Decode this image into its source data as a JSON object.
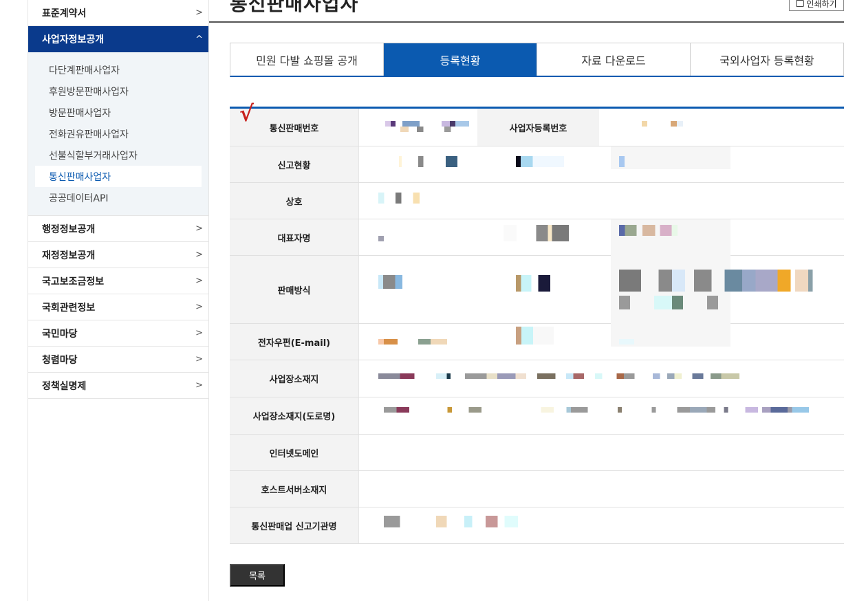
{
  "sidebar": {
    "items_top": [
      {
        "label": "표준계약서"
      }
    ],
    "active_section": {
      "label": "사업자정보공개"
    },
    "sub_items": [
      {
        "label": "다단계판매사업자"
      },
      {
        "label": "후원방문판매사업자"
      },
      {
        "label": "방문판매사업자"
      },
      {
        "label": "전화권유판매사업자"
      },
      {
        "label": "선불식할부거래사업자"
      },
      {
        "label": "통신판매사업자"
      },
      {
        "label": "공공데이터API"
      }
    ],
    "items_bottom": [
      {
        "label": "행정정보공개"
      },
      {
        "label": "재정정보공개"
      },
      {
        "label": "국고보조금정보"
      },
      {
        "label": "국회관련정보"
      },
      {
        "label": "국민마당"
      },
      {
        "label": "청렴마당"
      },
      {
        "label": "정책실명제"
      }
    ]
  },
  "header": {
    "title": "통신판매사업자",
    "print_label": "인쇄하기"
  },
  "tabs": [
    {
      "label": "민원 다발 쇼핑몰 공개"
    },
    {
      "label": "등록현황"
    },
    {
      "label": "자료 다운로드"
    },
    {
      "label": "국외사업자 등록현황"
    }
  ],
  "table": {
    "check": "√",
    "rows": [
      {
        "label": "통신판매번호",
        "label2": "사업자등록번호"
      },
      {
        "label": "신고현황"
      },
      {
        "label": "상호"
      },
      {
        "label": "대표자명"
      },
      {
        "label": "판매방식"
      },
      {
        "label": "전자우편(E-mail)"
      },
      {
        "label": "사업장소재지"
      },
      {
        "label": "사업장소재지(도로명)"
      },
      {
        "label": "인터넷도메인"
      },
      {
        "label": "호스트서버소재지"
      },
      {
        "label": "통신판매업 신고기관명"
      }
    ]
  },
  "footer": {
    "list_button": "목록"
  }
}
